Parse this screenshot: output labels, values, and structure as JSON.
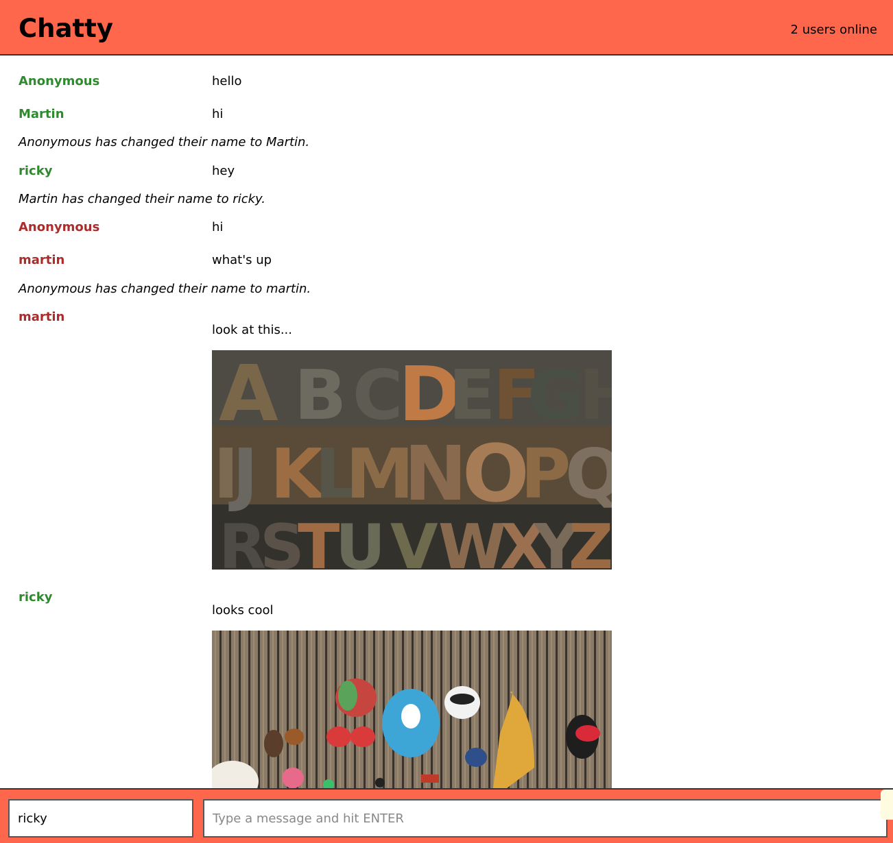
{
  "header": {
    "title": "Chatty",
    "users_online": "2 users online"
  },
  "messages": [
    {
      "type": "message",
      "username": "Anonymous",
      "color": "#2f8a2f",
      "content": "hello"
    },
    {
      "type": "message",
      "username": "Martin",
      "color": "#2f8a2f",
      "content": "hi"
    },
    {
      "type": "system",
      "content": "Anonymous has changed their name to Martin."
    },
    {
      "type": "message",
      "username": "ricky",
      "color": "#2f8a2f",
      "content": "hey"
    },
    {
      "type": "system",
      "content": "Martin has changed their name to ricky."
    },
    {
      "type": "message",
      "username": "Anonymous",
      "color": "#ac2b2b",
      "content": "hi"
    },
    {
      "type": "message",
      "username": "martin",
      "color": "#ac2b2b",
      "content": "what's up"
    },
    {
      "type": "system",
      "content": "Anonymous has changed their name to martin."
    },
    {
      "type": "message",
      "username": "martin",
      "color": "#ac2b2b",
      "content": "look at this...",
      "image": "wooden-letterpress-alphabet"
    },
    {
      "type": "message",
      "username": "ricky",
      "color": "#2f8a2f",
      "content": "looks cool",
      "image": "toys-on-wooden-deck"
    }
  ],
  "footer": {
    "username_value": "ricky",
    "message_placeholder": "Type a message and hit ENTER"
  },
  "colors": {
    "bar": "#ff674d",
    "user_green": "#2f8a2f",
    "user_red": "#ac2b2b"
  }
}
